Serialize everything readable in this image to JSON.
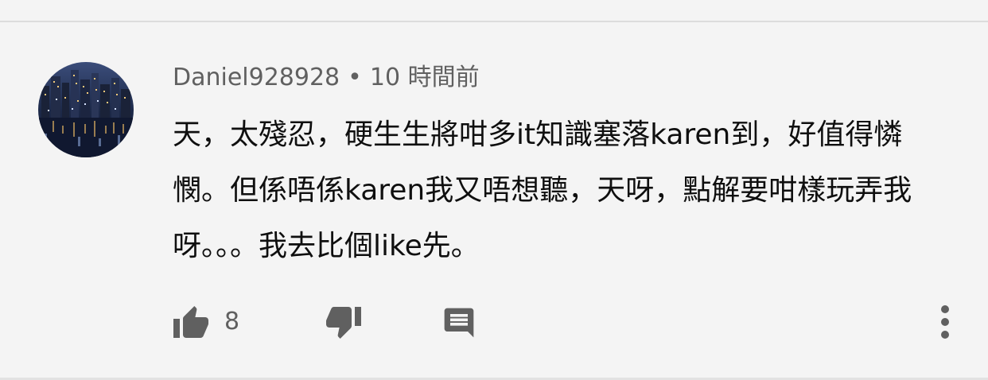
{
  "comment": {
    "author": "Daniel928928",
    "separator": "•",
    "time": "10 時間前",
    "text": "天，太殘忍，硬生生將咁多it知識塞落karen到，好值得憐憫。但係唔係karen我又唔想聽，天呀，點解要咁樣玩弄我呀。。。我去比個like先。",
    "like_count": "8"
  },
  "icons": {
    "like": "thumb-up-icon",
    "dislike": "thumb-down-icon",
    "reply": "comment-icon",
    "more": "more-vert-icon"
  },
  "colors": {
    "background": "#f4f4f4",
    "text_primary": "#0f0f0f",
    "text_secondary": "#606060",
    "icon": "#606060"
  }
}
